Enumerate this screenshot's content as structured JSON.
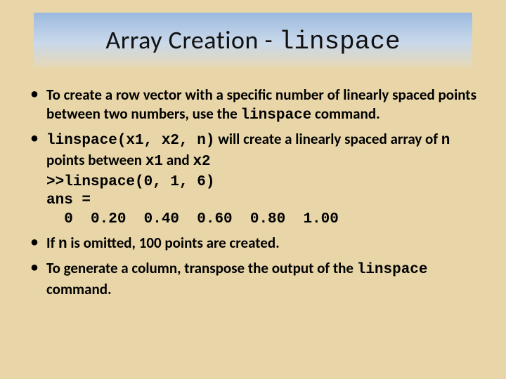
{
  "title": {
    "prefix": "Array Creation - ",
    "mono": "linspace"
  },
  "bullets": {
    "b1": {
      "t1": "To create a row vector with a specific number of linearly spaced points between two numbers, use the ",
      "m1": "linspace",
      "t2": " command."
    },
    "b2": {
      "m1": "linspace(x1, x2, n)",
      "t1": " will create a linearly spaced array of ",
      "m2": "n",
      "t2": " points between  ",
      "m3": "x1",
      "t3": " and ",
      "m4": "x2",
      "code": ">>linspace(0, 1, 6)\nans =\n  0  0.20  0.40  0.60  0.80  1.00"
    },
    "b3": {
      "t1": "If ",
      "m1": "n",
      "t2": " is omitted, 100 points are created."
    },
    "b4": {
      "t1": "To generate a column, transpose the output of the ",
      "m1": "linspace",
      "t2": " command."
    }
  }
}
